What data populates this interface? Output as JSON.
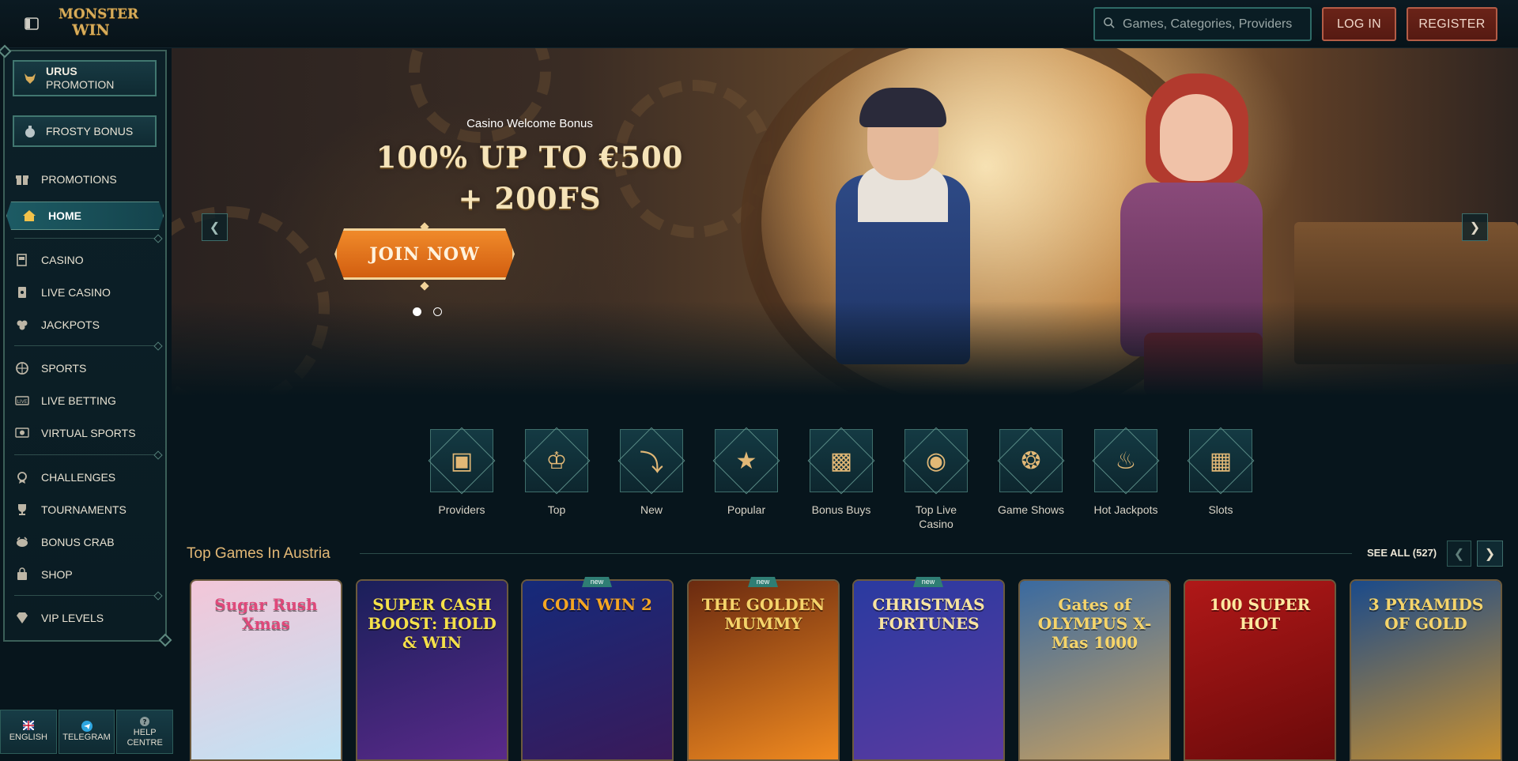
{
  "header": {
    "logo_line1": "MONSTER",
    "logo_line2": "WIN",
    "search_placeholder": "Games, Categories, Providers",
    "login_label": "LOG IN",
    "register_label": "REGISTER"
  },
  "sidebar": {
    "promo_urus_line1": "URUS",
    "promo_urus_line2": "PROMOTION",
    "promo_frosty": "FROSTY BONUS",
    "items": [
      {
        "label": "PROMOTIONS",
        "icon": "gift-icon"
      },
      {
        "label": "HOME",
        "icon": "home-icon",
        "active": true
      },
      {
        "label": "CASINO",
        "icon": "slot-machine-icon"
      },
      {
        "label": "LIVE CASINO",
        "icon": "cards-icon"
      },
      {
        "label": "JACKPOTS",
        "icon": "clover-icon"
      },
      {
        "label": "SPORTS",
        "icon": "ball-icon"
      },
      {
        "label": "LIVE BETTING",
        "icon": "live-icon"
      },
      {
        "label": "VIRTUAL SPORTS",
        "icon": "virtual-icon"
      },
      {
        "label": "CHALLENGES",
        "icon": "medal-icon"
      },
      {
        "label": "TOURNAMENTS",
        "icon": "trophy-icon"
      },
      {
        "label": "BONUS CRAB",
        "icon": "crab-icon"
      },
      {
        "label": "SHOP",
        "icon": "bag-icon"
      },
      {
        "label": "VIP LEVELS",
        "icon": "diamond-icon"
      }
    ]
  },
  "bottom_buttons": {
    "english": "ENGLISH",
    "telegram": "TELEGRAM",
    "help_line1": "HELP",
    "help_line2": "CENTRE"
  },
  "hero": {
    "subtitle": "Casino Welcome Bonus",
    "title_line1": "100% UP TO €500",
    "title_line2": "+ 200FS",
    "cta": "JOIN NOW",
    "slide_count": 2,
    "active_slide": 1
  },
  "categories": [
    {
      "label": "Providers",
      "icon": "book-icon"
    },
    {
      "label": "Top",
      "icon": "crown-icon"
    },
    {
      "label": "New",
      "icon": "lightning-icon"
    },
    {
      "label": "Popular",
      "icon": "star-icon"
    },
    {
      "label": "Bonus Buys",
      "icon": "chest-icon"
    },
    {
      "label": "Top Live Casino",
      "icon": "chip-icon"
    },
    {
      "label": "Game Shows",
      "icon": "wheel-icon"
    },
    {
      "label": "Hot Jackpots",
      "icon": "flame-icon"
    },
    {
      "label": "Slots",
      "icon": "slot-icon"
    }
  ],
  "section": {
    "title": "Top Games In Austria",
    "see_all": "SEE ALL (527)"
  },
  "games": [
    {
      "name": "Sugar Rush Xmas",
      "new": false,
      "bg1": "#f3c6d8",
      "bg2": "#bfe3f5",
      "color": "#e0487a"
    },
    {
      "name": "SUPER CASH BOOST: HOLD & WIN",
      "new": false,
      "bg1": "#1a1f5a",
      "bg2": "#5a2a8a",
      "color": "#f4e04a"
    },
    {
      "name": "COIN WIN 2",
      "new": true,
      "new_label": "new",
      "bg1": "#152a7a",
      "bg2": "#3a1a5a",
      "color": "#f5a623"
    },
    {
      "name": "THE GOLDEN MUMMY",
      "new": true,
      "new_label": "new",
      "bg1": "#6a2a10",
      "bg2": "#f08a20",
      "color": "#f5d46a"
    },
    {
      "name": "CHRISTMAS FORTUNES",
      "new": true,
      "new_label": "new",
      "bg1": "#2a3aa0",
      "bg2": "#5a3aa0",
      "color": "#f7e3a0"
    },
    {
      "name": "Gates of OLYMPUS X-Mas 1000",
      "new": false,
      "bg1": "#3a6aa0",
      "bg2": "#c8a060",
      "color": "#f5d46a"
    },
    {
      "name": "100 SUPER HOT",
      "new": false,
      "bg1": "#b01818",
      "bg2": "#6a0a0a",
      "color": "#ffe9a0"
    },
    {
      "name": "3 PYRAMIDS OF GOLD",
      "new": false,
      "bg1": "#1a4a8a",
      "bg2": "#c89030",
      "color": "#f5d46a"
    }
  ]
}
